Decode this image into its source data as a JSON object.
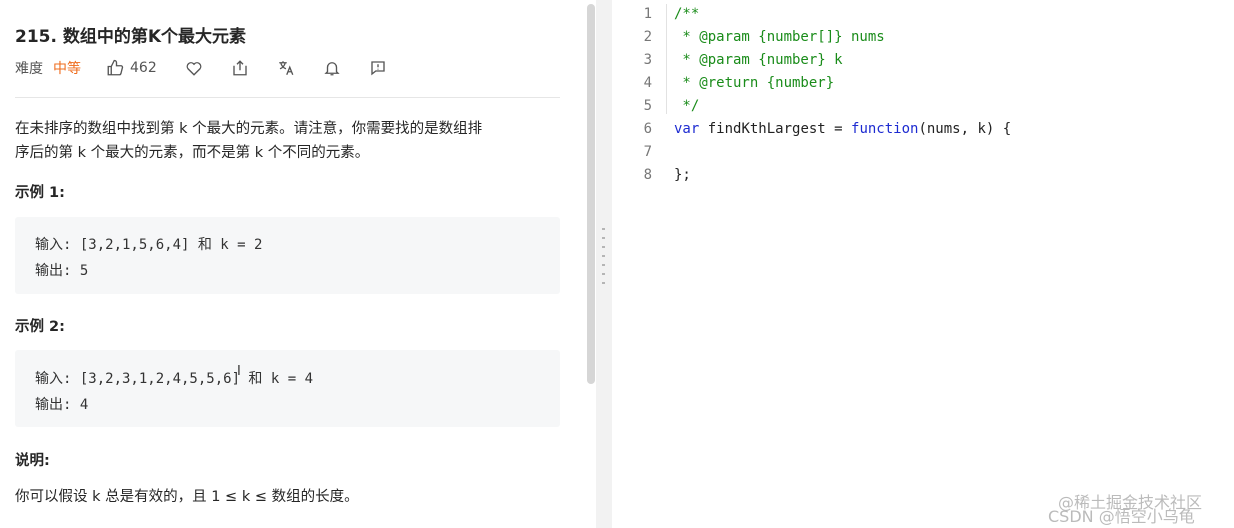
{
  "problem": {
    "title": "215. 数组中的第K个最大元素",
    "difficulty_label": "难度",
    "difficulty": "中等",
    "likes": "462",
    "description_line1": "在未排序的数组中找到第 k 个最大的元素。请注意，你需要找的是数组排",
    "description_line2": "序后的第 k 个最大的元素，而不是第 k 个不同的元素。",
    "example1_heading": "示例 1:",
    "example1_input": "输入: [3,2,1,5,6,4] 和 k = 2",
    "example1_output": "输出: 5",
    "example2_heading": "示例 2:",
    "example2_input": "输入: [3,2,3,1,2,4,5,5,6] 和 k = 4",
    "example2_output": "输出: 4",
    "note_heading": "说明:",
    "note_text": "你可以假设 k 总是有效的，且 1 ≤ k ≤ 数组的长度。"
  },
  "icons": [
    "thumbs-up-icon",
    "heart-icon",
    "share-icon",
    "translate-icon",
    "bell-icon",
    "comment-icon"
  ],
  "colors": {
    "difficulty": "#ef6c1d",
    "comment": "#1a8c1a",
    "keyword": "#1d2bd1"
  },
  "editor": {
    "lines": [
      {
        "n": "1",
        "a": "/**"
      },
      {
        "n": "2",
        "a": " * @param {number[]} nums"
      },
      {
        "n": "3",
        "a": " * @param {number} k"
      },
      {
        "n": "4",
        "a": " * @return {number}"
      },
      {
        "n": "5",
        "a": " */"
      },
      {
        "n": "6",
        "a": "var",
        "b": " findKthLargest = ",
        "c": "function",
        "d": "(nums, k) {"
      },
      {
        "n": "7",
        "a": ""
      },
      {
        "n": "8",
        "a": "};"
      }
    ]
  },
  "watermark": {
    "line1": "@稀土掘金技术社区",
    "line2": "CSDN @悟空小乌龟"
  }
}
